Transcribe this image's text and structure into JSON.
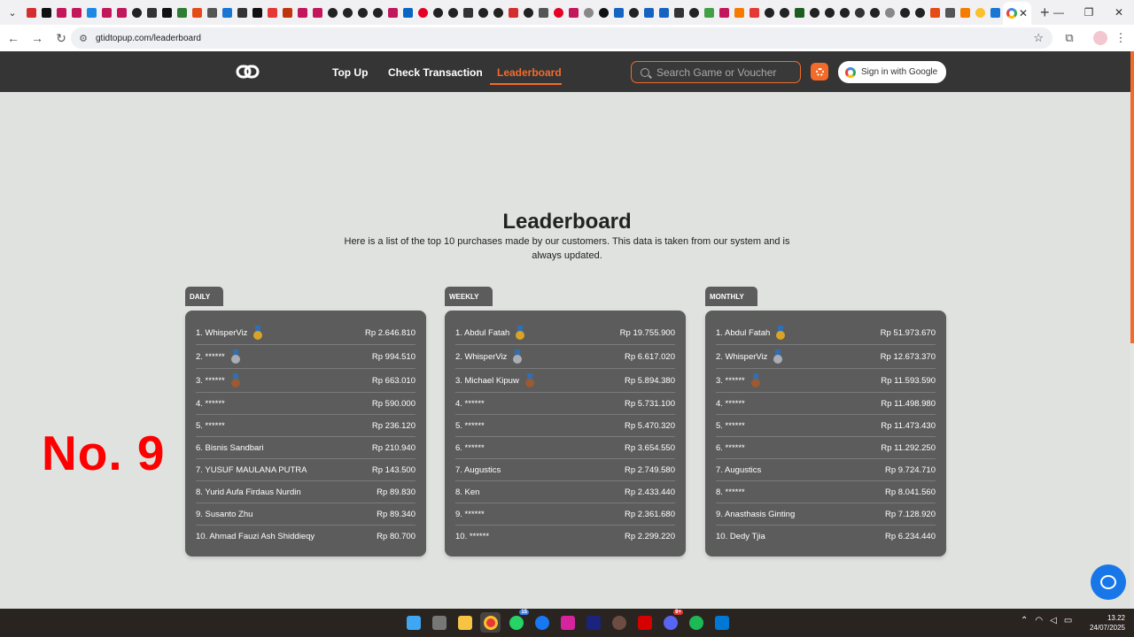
{
  "browser": {
    "url": "gtidtopup.com/leaderboard"
  },
  "header": {
    "nav": [
      {
        "label": "Top Up"
      },
      {
        "label": "Check Transaction"
      },
      {
        "label": "Leaderboard"
      }
    ],
    "search_placeholder": "Search Game or Voucher",
    "signin_label": "Sign in with Google",
    "accent_color": "#f26b2a"
  },
  "page": {
    "title": "Leaderboard",
    "subtitle": "Here is a list of the top 10 purchases made by our customers. This data is taken from our system and is always updated.",
    "overlay_label": "No. 9"
  },
  "boards": [
    {
      "tag": "DAILY",
      "rows": [
        {
          "name": "1. WhisperViz",
          "amount": "Rp 2.646.810",
          "medal": "gold"
        },
        {
          "name": "2. ******",
          "amount": "Rp 994.510",
          "medal": "silver"
        },
        {
          "name": "3. ******",
          "amount": "Rp 663.010",
          "medal": "bronze"
        },
        {
          "name": "4. ******",
          "amount": "Rp 590.000"
        },
        {
          "name": "5. ******",
          "amount": "Rp 236.120"
        },
        {
          "name": "6. Bisnis Sandbari",
          "amount": "Rp 210.940"
        },
        {
          "name": "7. YUSUF MAULANA PUTRA",
          "amount": "Rp 143.500"
        },
        {
          "name": "8. Yurid Aufa Firdaus Nurdin",
          "amount": "Rp 89.830"
        },
        {
          "name": "9. Susanto Zhu",
          "amount": "Rp 89.340"
        },
        {
          "name": "10. Ahmad Fauzi Ash Shiddieqy",
          "amount": "Rp 80.700"
        }
      ]
    },
    {
      "tag": "WEEKLY",
      "rows": [
        {
          "name": "1. Abdul Fatah",
          "amount": "Rp 19.755.900",
          "medal": "gold"
        },
        {
          "name": "2. WhisperViz",
          "amount": "Rp 6.617.020",
          "medal": "silver"
        },
        {
          "name": "3. Michael Kipuw",
          "amount": "Rp 5.894.380",
          "medal": "bronze"
        },
        {
          "name": "4. ******",
          "amount": "Rp 5.731.100"
        },
        {
          "name": "5. ******",
          "amount": "Rp 5.470.320"
        },
        {
          "name": "6. ******",
          "amount": "Rp 3.654.550"
        },
        {
          "name": "7. Augustics",
          "amount": "Rp 2.749.580"
        },
        {
          "name": "8. Ken",
          "amount": "Rp 2.433.440"
        },
        {
          "name": "9. ******",
          "amount": "Rp 2.361.680"
        },
        {
          "name": "10. ******",
          "amount": "Rp 2.299.220"
        }
      ]
    },
    {
      "tag": "MONTHLY",
      "rows": [
        {
          "name": "1. Abdul Fatah",
          "amount": "Rp 51.973.670",
          "medal": "gold"
        },
        {
          "name": "2. WhisperViz",
          "amount": "Rp 12.673.370",
          "medal": "silver"
        },
        {
          "name": "3. ******",
          "amount": "Rp 11.593.590",
          "medal": "bronze"
        },
        {
          "name": "4. ******",
          "amount": "Rp 11.498.980"
        },
        {
          "name": "5. ******",
          "amount": "Rp 11.473.430"
        },
        {
          "name": "6. ******",
          "amount": "Rp 11.292.250"
        },
        {
          "name": "7. Augustics",
          "amount": "Rp 9.724.710"
        },
        {
          "name": "8. ******",
          "amount": "Rp 8.041.560"
        },
        {
          "name": "9. Anasthasis Ginting",
          "amount": "Rp 7.128.920"
        },
        {
          "name": "10. Dedy Tjia",
          "amount": "Rp 6.234.440"
        }
      ]
    }
  ],
  "taskbar": {
    "time": "13.22",
    "date": "24/07/2025",
    "whatsapp_badge": "15",
    "discord_badge": "9+"
  }
}
